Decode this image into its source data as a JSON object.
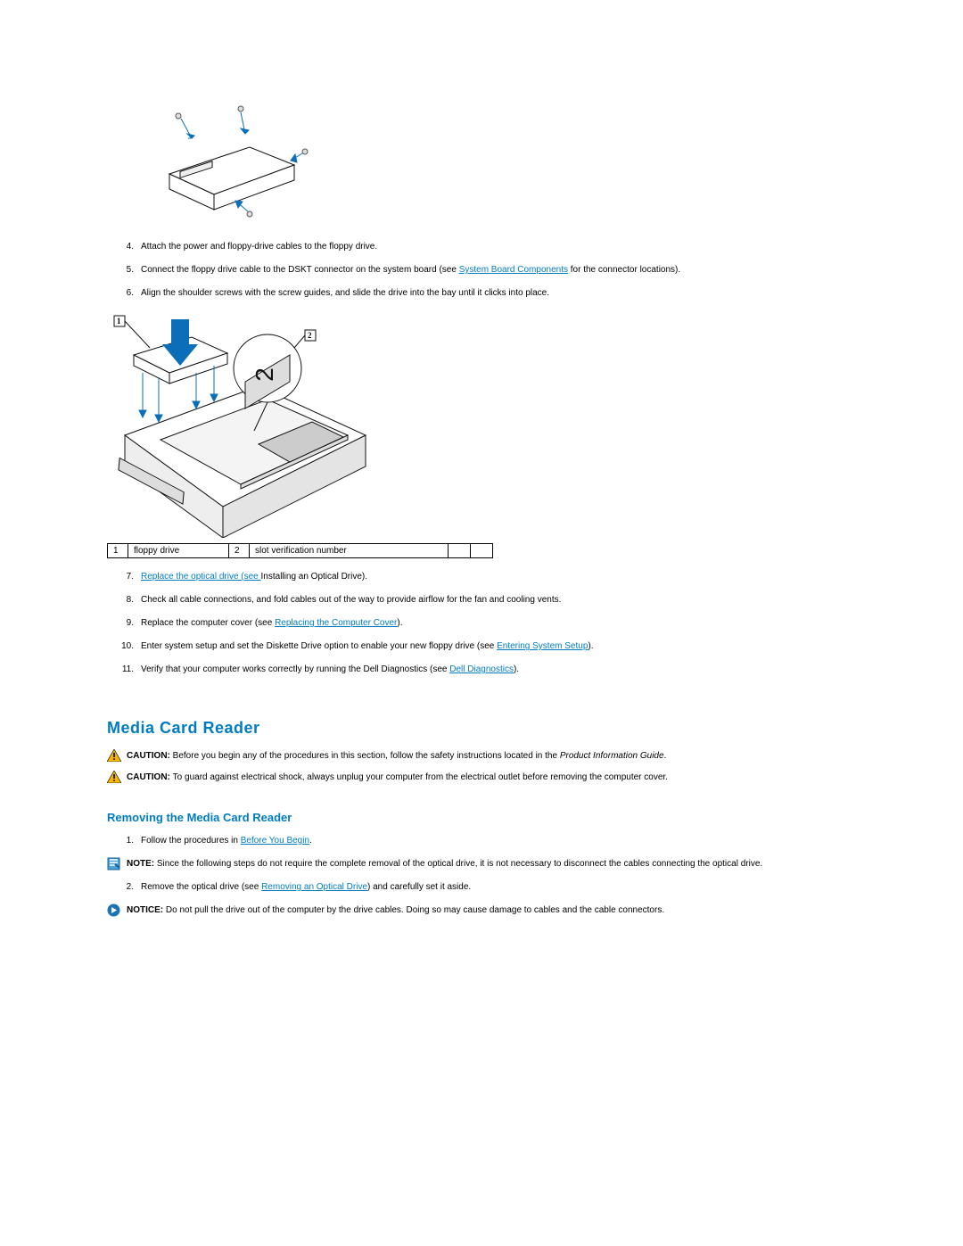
{
  "steps_a": {
    "s4": {
      "num": "4.",
      "text": "Attach the power and floppy-drive cables to the floppy drive."
    },
    "s5": {
      "num": "5.",
      "pre": "Connect the floppy drive cable to the DSKT connector on the system board (see ",
      "link": "System Board Components",
      "post": " for the connector locations)."
    },
    "s6": {
      "num": "6.",
      "text": "Align the shoulder screws with the screw guides, and slide the drive into the bay until it clicks into place."
    }
  },
  "callouts": {
    "r1c1": "1",
    "r1c2": "floppy drive",
    "r2c1": "2",
    "r2c2": "slot verification number"
  },
  "steps_b": {
    "s7": {
      "num": "7.",
      "link": "Replace the optical drive (see ",
      "post_link_text": "Installing an Optical Drive).",
      "link_full": "Replace the optical drive (see "
    },
    "s8": {
      "num": "8.",
      "text": "Check all cable connections, and fold cables out of the way to provide airflow for the fan and cooling vents."
    },
    "s9": {
      "num": "9.",
      "pre": "Replace the computer cover (see ",
      "link": "Replacing the Computer Cover",
      "post": ")."
    },
    "s10": {
      "num": "10.",
      "pre": "Enter system setup and set the Diskette Drive option to enable your new floppy drive (see ",
      "link": "Entering System Setup",
      "post": ")."
    },
    "s11": {
      "num": "11.",
      "pre": "Verify that your computer works correctly by running the Dell Diagnostics (see ",
      "link": "Dell Diagnostics",
      "post": ")."
    }
  },
  "section": {
    "title": "Media Card Reader"
  },
  "cautions": {
    "c1": {
      "lead": "CAUTION: ",
      "pre": "Before you begin any of the procedures in this section, follow the safety instructions located in the ",
      "ital": "Product Information Guide",
      "post": "."
    },
    "c2": {
      "lead": "CAUTION: ",
      "text": "To guard against electrical shock, always unplug your computer from the electrical outlet before removing the computer cover."
    }
  },
  "subsection": {
    "title": "Removing the Media Card Reader"
  },
  "steps_c": {
    "s1": {
      "num": "1.",
      "pre": "Follow the procedures in ",
      "link": "Before You Begin",
      "post": "."
    },
    "s2": {
      "num": "2.",
      "pre": "Remove the optical drive (see ",
      "link": "Removing an Optical Drive",
      "post": ") and carefully set it aside."
    }
  },
  "note": {
    "lead": "NOTE: ",
    "text": "Since the following steps do not require the complete removal of the optical drive, it is not necessary to disconnect the cables connecting the optical drive."
  },
  "notice": {
    "lead": "NOTICE: ",
    "text": "Do not pull the drive out of the computer by the drive cables. Doing so may cause damage to cables and the cable connectors."
  },
  "fig2_labels": {
    "l1": "1",
    "l2": "2"
  }
}
